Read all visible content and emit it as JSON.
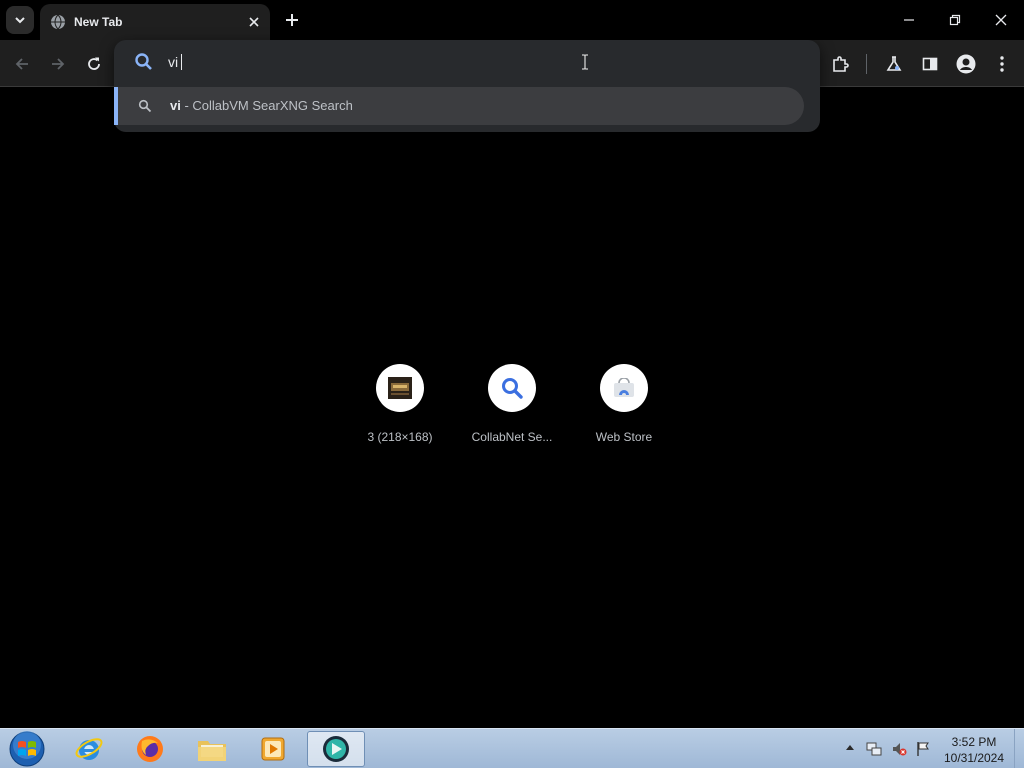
{
  "browser": {
    "tab": {
      "title": "New Tab"
    },
    "omnibox": {
      "input_value": "vi",
      "suggestion": {
        "query": "vi",
        "separator": " - ",
        "engine": "CollabVM SearXNG Search"
      }
    },
    "shortcuts": [
      {
        "label": "3 (218×168)",
        "icon": "thumbnail-image-icon"
      },
      {
        "label": "CollabNet Se...",
        "icon": "search-icon"
      },
      {
        "label": "Web Store",
        "icon": "web-store-icon"
      }
    ],
    "colors": {
      "accent": "#8ab4f8",
      "toolbar": "#1f1f1f",
      "popup": "#282a2d"
    }
  },
  "taskbar": {
    "apps": [
      {
        "name": "internet-explorer",
        "icon": "ie-icon"
      },
      {
        "name": "firefox",
        "icon": "firefox-icon"
      },
      {
        "name": "file-explorer",
        "icon": "folder-icon"
      },
      {
        "name": "media-player",
        "icon": "media-player-icon"
      },
      {
        "name": "chrome-canary",
        "icon": "browser-icon",
        "active": true
      }
    ],
    "clock": {
      "time": "3:52 PM",
      "date": "10/31/2024"
    }
  }
}
